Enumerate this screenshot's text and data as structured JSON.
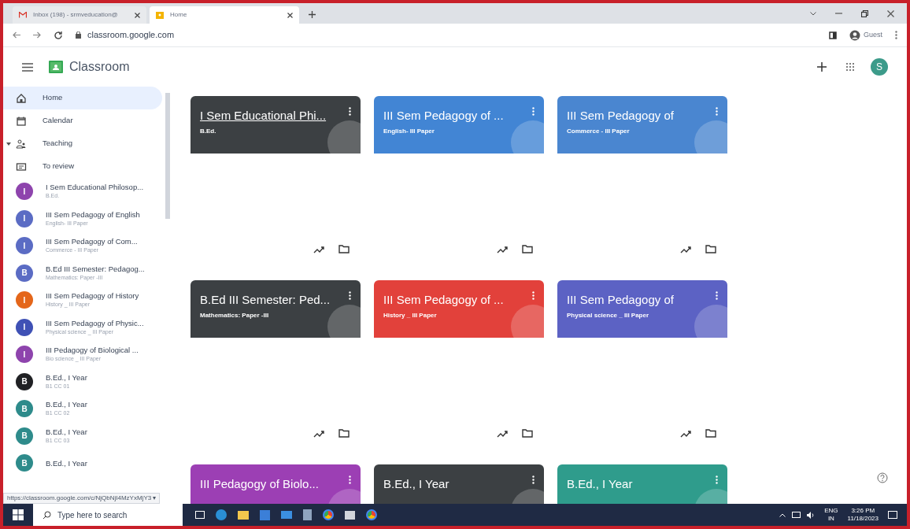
{
  "browser": {
    "tabs": [
      {
        "label": "Inbox (198) - srmveducation@",
        "selected": false
      },
      {
        "label": "Home",
        "selected": true
      }
    ],
    "url": "classroom.google.com",
    "profile": "Guest"
  },
  "app": {
    "title": "Classroom",
    "avatar": "S"
  },
  "sidebar": {
    "items": [
      {
        "kind": "home",
        "label": "Home",
        "selected": true
      },
      {
        "kind": "calendar",
        "label": "Calendar",
        "selected": false
      },
      {
        "kind": "group",
        "label": "Teaching",
        "selected": false,
        "expanded": true
      },
      {
        "kind": "review",
        "label": "To review",
        "selected": false
      },
      {
        "kind": "course",
        "letter": "I",
        "color": "#8e44ad",
        "label": "I Sem Educational Philosop...",
        "sub": "B.Ed.",
        "selected": false
      },
      {
        "kind": "course",
        "letter": "I",
        "color": "#5b6cc4",
        "label": "III Sem Pedagogy of English",
        "sub": "English- III Paper",
        "selected": false
      },
      {
        "kind": "course",
        "letter": "I",
        "color": "#5b6cc4",
        "label": "III Sem Pedagogy of Com...",
        "sub": "Commerce - III Paper",
        "selected": false
      },
      {
        "kind": "course",
        "letter": "B",
        "color": "#5b6cc4",
        "label": "B.Ed III Semester: Pedagog...",
        "sub": "Mathematics: Paper -III",
        "selected": false
      },
      {
        "kind": "course",
        "letter": "I",
        "color": "#e4661a",
        "label": "III Sem Pedagogy of History",
        "sub": "History _ III Paper",
        "selected": false
      },
      {
        "kind": "course",
        "letter": "I",
        "color": "#3f51b5",
        "label": "III Sem Pedagogy of Physic...",
        "sub": "Physical science _ III Paper",
        "selected": false
      },
      {
        "kind": "course",
        "letter": "I",
        "color": "#8e44ad",
        "label": "III Pedagogy of Biological ...",
        "sub": "Bio science _ III Paper",
        "selected": false
      },
      {
        "kind": "course",
        "letter": "B",
        "color": "#202124",
        "label": "B.Ed., I Year",
        "sub": "B1 CC 01",
        "selected": false
      },
      {
        "kind": "course",
        "letter": "B",
        "color": "#2e8b8b",
        "label": "B.Ed., I Year",
        "sub": "B1 CC 02",
        "selected": false
      },
      {
        "kind": "course",
        "letter": "B",
        "color": "#2e8b8b",
        "label": "B.Ed., I Year",
        "sub": "B1 CC 03",
        "selected": false
      },
      {
        "kind": "course",
        "letter": "B",
        "color": "#2e8b8b",
        "label": "B.Ed., I Year",
        "selected": false
      }
    ]
  },
  "status_url": "https://classroom.google.com/c/NjQbNjI4MzYxMjY3 ▾",
  "cards": [
    {
      "title": "I Sem Educational Phi...",
      "sub": "B.Ed.",
      "color": "#3c4043",
      "underlined": true
    },
    {
      "title": "III Sem Pedagogy of ...",
      "sub": "English- III Paper",
      "color": "#4285d4",
      "underlined": false
    },
    {
      "title": "III Sem Pedagogy of",
      "sub": "Commerce - III Paper",
      "color": "#4a86d0",
      "underlined": false
    },
    {
      "title": "B.Ed III Semester: Ped...",
      "sub": "Mathematics: Paper -III",
      "color": "#3c4043",
      "underlined": false
    },
    {
      "title": "III Sem Pedagogy of ...",
      "sub": "History _ III Paper",
      "color": "#e2413b",
      "underlined": false
    },
    {
      "title": "III Sem Pedagogy of",
      "sub": "Physical science _ III Paper",
      "color": "#5c62c4",
      "underlined": false
    },
    {
      "title": "III Pedagogy of Biolo...",
      "color": "#9c3fb4",
      "underlined": false
    },
    {
      "title": "B.Ed., I Year",
      "color": "#3c4043",
      "underlined": false
    },
    {
      "title": "B.Ed., I Year",
      "color": "#2f9c8c",
      "underlined": false
    }
  ],
  "taskbar": {
    "search_placeholder": "Type here to search",
    "language": "ENG",
    "region": "IN",
    "time": "3:26 PM",
    "date": "11/18/2023"
  }
}
